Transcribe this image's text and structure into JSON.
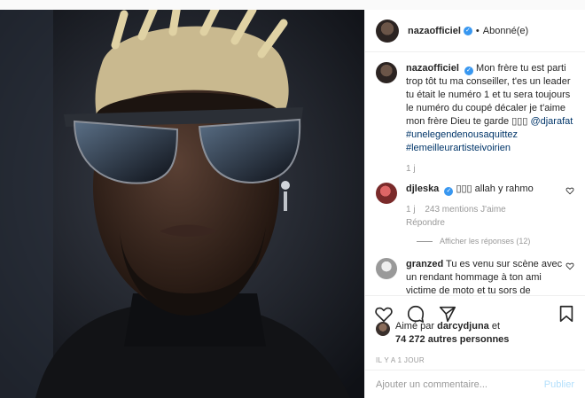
{
  "post": {
    "username": "nazaofficiel",
    "follow_status": "Abonné(e)",
    "separator": "•"
  },
  "caption": {
    "username": "nazaofficiel",
    "text": "Mon frère tu est parti trop tôt tu ma conseiller, t'es un leader tu était le numéro 1 et tu sera toujours le numéro du coupé décaler je t'aime mon frère Dieu te garde ▯▯▯",
    "mention": "@djarafat",
    "hashtag1": "#unelegendenousaquittez",
    "hashtag2": "#lemeilleurartisteivoirien",
    "time": "1 j"
  },
  "comments": [
    {
      "username": "djleska",
      "text": "▯▯▯ allah y rahmo",
      "time": "1 j",
      "likes": "243 mentions J'aime",
      "reply": "Répondre",
      "show_replies": "Afficher les réponses (12)"
    },
    {
      "username": "granzed",
      "text": "Tu es venu sur scène avec un rendant hommage à ton ami victime de moto et tu sors de"
    }
  ],
  "likes": {
    "prefix": "Aimé par",
    "user": "darcydjuna",
    "conj": "et",
    "others": "74 272 autres personnes"
  },
  "timestamp": "IL Y A 1 JOUR",
  "add_comment": {
    "placeholder": "Ajouter un commentaire...",
    "publish": "Publier"
  },
  "icons": {
    "like": "heart-icon",
    "comment": "comment-icon",
    "share": "share-icon",
    "save": "bookmark-icon",
    "verified": "verified-badge-icon"
  }
}
